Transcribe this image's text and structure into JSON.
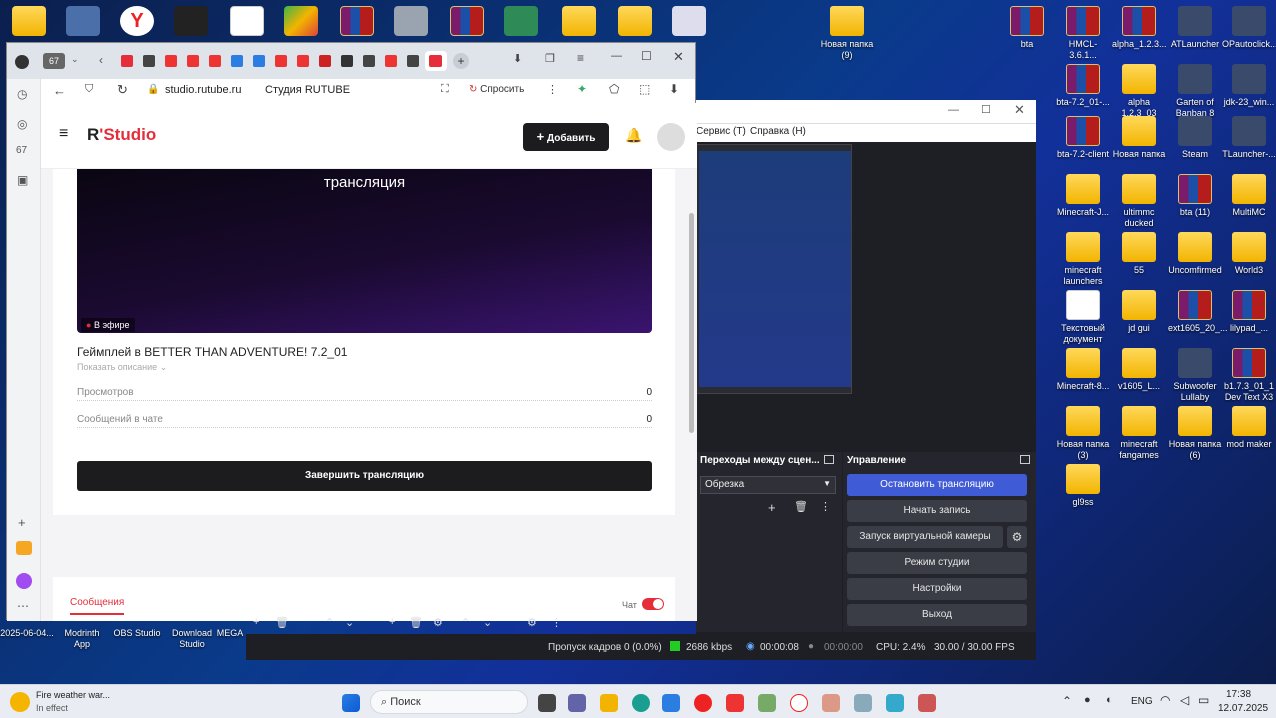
{
  "desktop": {
    "right_icons": [
      {
        "label": "Новая папка\n(9)",
        "type": "folder"
      },
      {
        "label": "bta",
        "type": "rar"
      },
      {
        "label": "HMCL-3.6.1...",
        "type": "rar"
      },
      {
        "label": "alpha_1.2.3...",
        "type": "rar"
      },
      {
        "label": "ATLauncher",
        "type": "app"
      },
      {
        "label": "OPautoclick...",
        "type": "app"
      },
      {
        "label": "bta-7.2_01-...",
        "type": "rar"
      },
      {
        "label": "alpha\n1.2.3_03",
        "type": "folder"
      },
      {
        "label": "Garten of\nBanban 8",
        "type": "app"
      },
      {
        "label": "jdk-23_win...",
        "type": "app"
      },
      {
        "label": "bta-7.2-client",
        "type": "rar"
      },
      {
        "label": "Новая папка",
        "type": "folder"
      },
      {
        "label": "Steam",
        "type": "app"
      },
      {
        "label": "TLauncher-...",
        "type": "app"
      },
      {
        "label": "Minecraft-J...",
        "type": "folder"
      },
      {
        "label": "ultimmc\nducked",
        "type": "folder"
      },
      {
        "label": "bta (11)",
        "type": "rar"
      },
      {
        "label": "MultiMC",
        "type": "folder"
      },
      {
        "label": "minecraft\nlaunchers",
        "type": "folder"
      },
      {
        "label": "55",
        "type": "folder"
      },
      {
        "label": "Uncomfirmed",
        "type": "folder"
      },
      {
        "label": "World3",
        "type": "folder"
      },
      {
        "label": "Текстовый\nдокумент",
        "type": "txt"
      },
      {
        "label": "jd gui",
        "type": "folder"
      },
      {
        "label": "ext1605_20_...",
        "type": "rar"
      },
      {
        "label": "lilypad_...",
        "type": "rar"
      },
      {
        "label": "Minecraft-8...",
        "type": "folder"
      },
      {
        "label": "v1605_L...",
        "type": "folder"
      },
      {
        "label": "Subwoofer\nLullaby",
        "type": "app"
      },
      {
        "label": "b1.7.3_01_1\nDev Text X3",
        "type": "rar"
      },
      {
        "label": "Новая папка\n(3)",
        "type": "folder"
      },
      {
        "label": "minecraft\nfangames",
        "type": "folder"
      },
      {
        "label": "Новая папка\n(6)",
        "type": "folder"
      },
      {
        "label": "mod maker",
        "type": "folder"
      },
      {
        "label": "gl9ss",
        "type": "folder"
      }
    ],
    "left_bottom_icons": [
      {
        "label": "2025-06-04..."
      },
      {
        "label": "Modrinth\nApp"
      },
      {
        "label": "OBS Studio"
      },
      {
        "label": "Download\nStudio"
      },
      {
        "label": "MEGA"
      }
    ]
  },
  "browser": {
    "tab_count": "67",
    "url": "studio.rutube.ru",
    "page_title": "Студия RUTUBE",
    "ask_label": "Спросить"
  },
  "studio": {
    "logo_r": "R",
    "logo_text": "Studio",
    "add_label": "Добавить",
    "video_caption": "трансляция",
    "live_badge": "В эфире",
    "stream_title": "Геймплей в BETTER THAN ADVENTURE! 7.2_01",
    "show_description": "Показать описание",
    "stats": [
      {
        "label": "Просмотров",
        "value": "0"
      },
      {
        "label": "Сообщений в чате",
        "value": "0"
      }
    ],
    "end_button": "Завершить трансляцию",
    "messages_tab": "Сообщения",
    "chat_label": "Чат",
    "chat_on": true
  },
  "obs": {
    "menu": [
      "Сервис (T)",
      "Справка (H)"
    ],
    "transitions_title": "Переходы между сцен...",
    "transition_value": "Обрезка",
    "controls_title": "Управление",
    "buttons": [
      "Остановить трансляцию",
      "Начать запись",
      "Запуск виртуальной камеры",
      "Режим студии",
      "Настройки",
      "Выход"
    ],
    "status": {
      "dropped": "Пропуск кадров 0 (0.0%)",
      "bitrate": "2686 kbps",
      "live_time": "00:00:08",
      "rec_time": "00:00:00",
      "cpu": "CPU: 2.4%",
      "fps": "30.00 / 30.00 FPS"
    }
  },
  "taskbar": {
    "weather_title": "Fire weather war...",
    "weather_sub": "In effect",
    "search_placeholder": "Поиск",
    "lang": "ENG",
    "time": "17:38",
    "date": "12.07.2025"
  },
  "colors": {
    "accent_red": "#e52e3a",
    "obs_blue": "#3f5bd6"
  }
}
